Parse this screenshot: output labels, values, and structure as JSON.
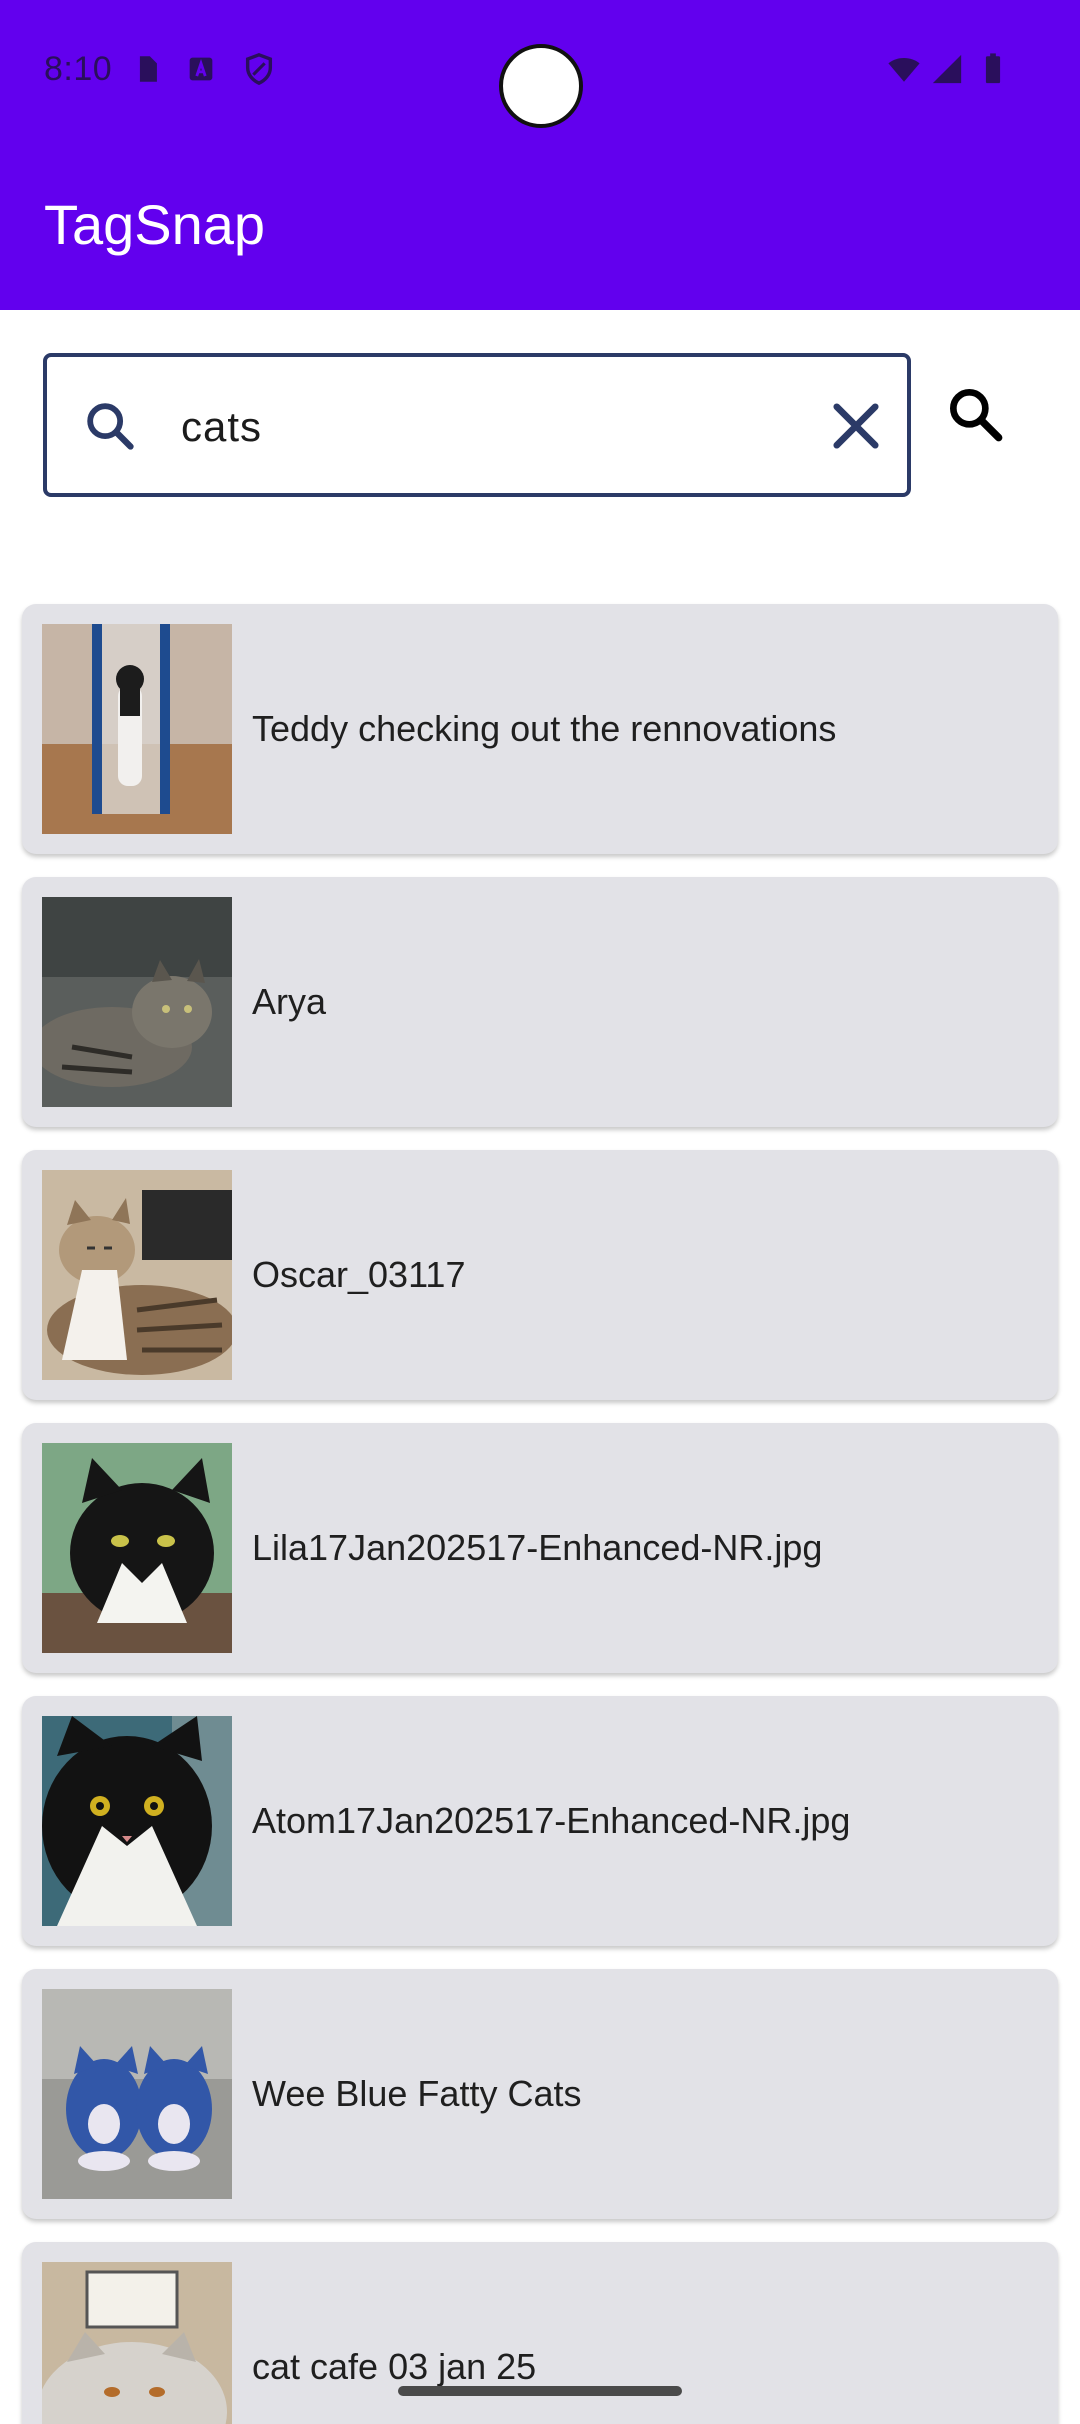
{
  "status_bar": {
    "time": "8:10",
    "left_icons": [
      "sim-card-icon",
      "font-download-icon",
      "shield-icon"
    ],
    "right_icons": [
      "wifi-icon",
      "signal-icon",
      "battery-icon"
    ]
  },
  "app_bar": {
    "title": "TagSnap",
    "color": "#6200EE"
  },
  "search": {
    "value": "cats",
    "placeholder": "",
    "leading_icon": "search-icon",
    "clear_icon": "close-icon",
    "action_icon": "search-icon"
  },
  "results": [
    {
      "label": "Teddy checking out the rennovations",
      "thumbnail": "cat-photo-renovation"
    },
    {
      "label": "Arya",
      "thumbnail": "cat-photo-tabby-lying"
    },
    {
      "label": "Oscar_03117",
      "thumbnail": "cat-photo-tabby-white"
    },
    {
      "label": "Lila17Jan202517-Enhanced-NR.jpg",
      "thumbnail": "cat-photo-black-white"
    },
    {
      "label": "Atom17Jan202517-Enhanced-NR.jpg",
      "thumbnail": "cat-photo-tuxedo"
    },
    {
      "label": "Wee Blue Fatty Cats",
      "thumbnail": "blue-cat-figurines"
    },
    {
      "label": "cat cafe 03 jan 25",
      "thumbnail": "cat-photo-cafe"
    }
  ]
}
